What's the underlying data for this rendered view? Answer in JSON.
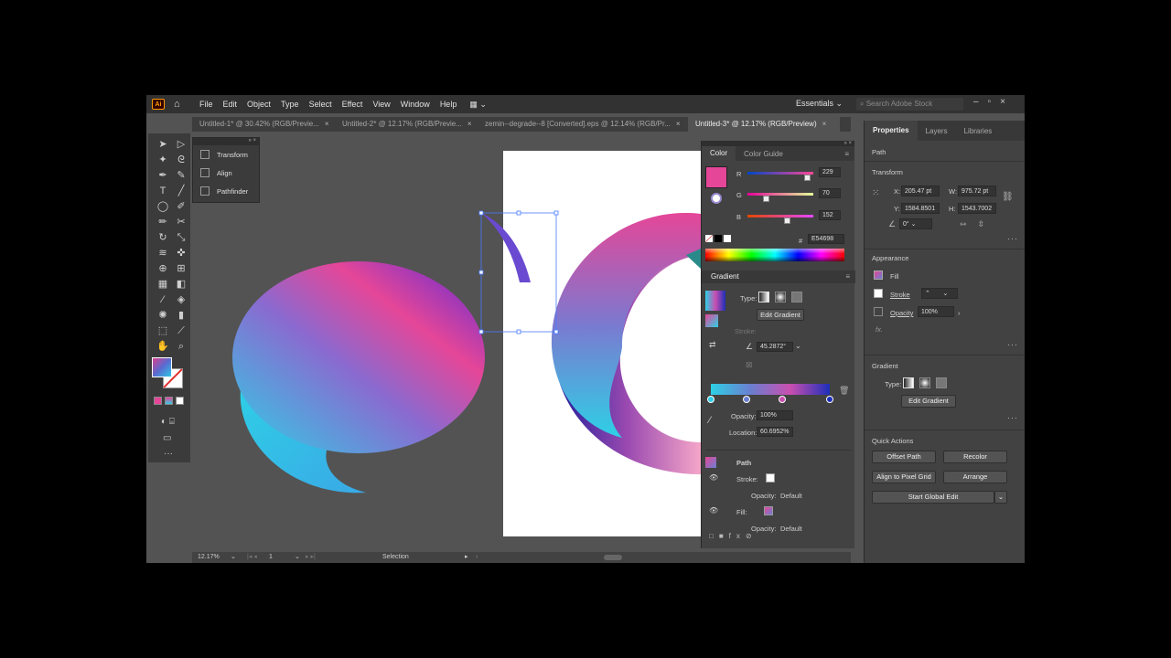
{
  "menubar": {
    "app_logo": "Ai",
    "items": [
      "File",
      "Edit",
      "Object",
      "Type",
      "Select",
      "Effect",
      "View",
      "Window",
      "Help"
    ],
    "workspace": "Essentials",
    "search_placeholder": "Search Adobe Stock"
  },
  "tabs": [
    {
      "label": "Untitled-1* @ 30.42% (RGB/Previe...",
      "close": "×"
    },
    {
      "label": "Untitled-2* @ 12.17% (RGB/Previe...",
      "close": "×"
    },
    {
      "label": "zemin--degrade--8 [Converted].eps @ 12.14% (RGB/Pr...",
      "close": "×"
    },
    {
      "label": "Untitled-3* @ 12.17% (RGB/Preview)",
      "close": "×"
    }
  ],
  "float_panel": {
    "items": [
      "Transform",
      "Align",
      "Pathfinder"
    ]
  },
  "status": {
    "zoom": "12.17%",
    "page": "1",
    "tool": "Selection"
  },
  "color_panel": {
    "tabs": [
      "Color",
      "Color Guide"
    ],
    "r_label": "R",
    "r_value": "229",
    "r_level": 0.898,
    "g_label": "G",
    "g_value": "70",
    "g_level": 0.274,
    "b_label": "B",
    "b_value": "152",
    "b_level": 0.596,
    "hex_symbol": "#",
    "hex": "E54698",
    "swatch_color": "#e54698"
  },
  "gradient_panel": {
    "title": "Gradient",
    "type_label": "Type:",
    "edit_gradient": "Edit Gradient",
    "stroke_label": "Stroke:",
    "angle": "45.2872°",
    "opacity_label": "Opacity:",
    "opacity": "100%",
    "location_label": "Location:",
    "location": "60.6952%",
    "stops": [
      "#2ed0e6",
      "#6a7fd0",
      "#c94fb0",
      "#1d2fb8"
    ]
  },
  "appearance_mini": {
    "path": "Path",
    "stroke_label": "Stroke:",
    "opacity_label": "Opacity:",
    "opacity_value": "Default",
    "fill_label": "Fill:",
    "opacity2_label": "Opacity:",
    "opacity2_value": "Default"
  },
  "properties": {
    "tabs": [
      "Properties",
      "Layers",
      "Libraries"
    ],
    "object_type": "Path",
    "transform_title": "Transform",
    "x_label": "X:",
    "x": "205.47 pt",
    "y_label": "Y:",
    "y": "1584.8501",
    "w_label": "W:",
    "w": "975.72 pt",
    "h_label": "H:",
    "h": "1543.7002",
    "angle": "0°",
    "appearance_title": "Appearance",
    "fill_label": "Fill",
    "stroke_label": "Stroke",
    "opacity_label": "Opacity",
    "opacity": "100%",
    "fx": "fx.",
    "gradient_title": "Gradient",
    "type_label": "Type:",
    "edit_gradient": "Edit Gradient",
    "quick_actions_title": "Quick Actions",
    "offset_path": "Offset Path",
    "recolor": "Recolor",
    "align_pixel": "Align to Pixel Grid",
    "arrange": "Arrange",
    "global_edit": "Start Global Edit"
  }
}
